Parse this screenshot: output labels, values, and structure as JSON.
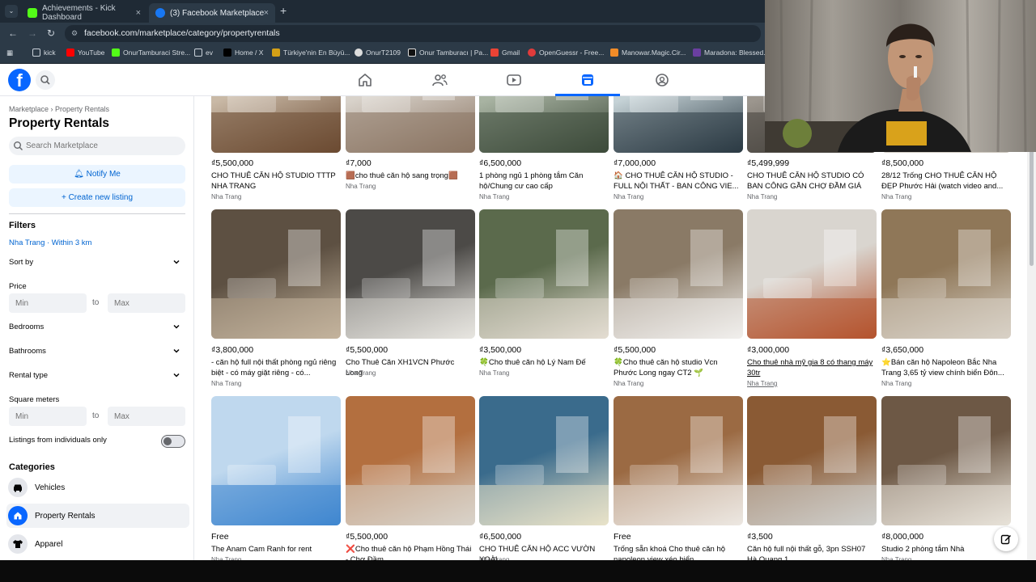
{
  "browser": {
    "tabs": [
      {
        "title": "Achievements - Kick Dashboard",
        "active": false,
        "favicon_color": "#53fc18"
      },
      {
        "title": "(3) Facebook Marketplace | Face",
        "active": true,
        "favicon_color": "#1877f2"
      }
    ],
    "url": "facebook.com/marketplace/category/propertyrentals",
    "bookmarks": [
      {
        "label": "kick",
        "icon": "folder-icon"
      },
      {
        "label": "YouTube",
        "icon": "youtube-icon"
      },
      {
        "label": "OnurTamburaci Stre...",
        "icon": "kick-icon"
      },
      {
        "label": "ev",
        "icon": "folder-icon"
      },
      {
        "label": "Home / X",
        "icon": "x-icon"
      },
      {
        "label": "Türkiye'nin En Büyü...",
        "icon": "bookmark-icon"
      },
      {
        "label": "OnurT2109",
        "icon": "bookmark-icon"
      },
      {
        "label": "Onur Tamburacı | Pa...",
        "icon": "bookmark-icon"
      },
      {
        "label": "Gmail",
        "icon": "gmail-icon"
      },
      {
        "label": "OpenGuessr - Free...",
        "icon": "bookmark-icon"
      },
      {
        "label": "Manowar.Magic.Cir...",
        "icon": "bookmark-icon"
      },
      {
        "label": "Maradona: Blessed...",
        "icon": "bookmark-icon"
      }
    ]
  },
  "sidebar": {
    "breadcrumb": "Marketplace › Property Rentals",
    "title": "Property Rentals",
    "search_placeholder": "Search Marketplace",
    "notify_label": "Notify Me",
    "create_label": "Create new listing",
    "filters_title": "Filters",
    "location_filter": "Nha Trang · Within 3 km",
    "sort_by": "Sort by",
    "price_label": "Price",
    "min_placeholder": "Min",
    "max_placeholder": "Max",
    "to_label": "to",
    "bedrooms": "Bedrooms",
    "bathrooms": "Bathrooms",
    "rental_type": "Rental type",
    "square_meters": "Square meters",
    "individuals_only": "Listings from individuals only",
    "categories_title": "Categories",
    "categories": [
      {
        "label": "Vehicles",
        "icon": "car-icon",
        "active": false
      },
      {
        "label": "Property Rentals",
        "icon": "house-icon",
        "active": true
      },
      {
        "label": "Apparel",
        "icon": "shirt-icon",
        "active": false
      }
    ]
  },
  "listings": [
    {
      "price": "₫5,500,000",
      "title": "CHO THUÊ CĂN HỘ STUDIO TTTP NHA TRANG",
      "location": "Nha Trang",
      "colors": [
        "#6b4a32",
        "#c9b9a6"
      ]
    },
    {
      "price": "₫7,000",
      "title": "🟫cho thuê căn hộ sang trọng🟫",
      "location": "Nha Trang",
      "colors": [
        "#8a7462",
        "#d8d2ca"
      ]
    },
    {
      "price": "₫6,500,000",
      "title": "1 phòng ngủ 1 phòng tắm Căn hộ/Chung cư cao cấp",
      "location": "Nha Trang",
      "colors": [
        "#3d4a3a",
        "#a8b3a2"
      ]
    },
    {
      "price": "₫7,000,000",
      "title": "🏠 CHO THUÊ CĂN HỘ STUDIO - FULL NỘI THẤT - BAN CÔNG VIE...",
      "location": "Nha Trang",
      "colors": [
        "#2b3a44",
        "#c5d2d6"
      ]
    },
    {
      "price": "₫5,499,999",
      "title": "CHO THUÊ CĂN HỘ STUDIO CÓ BAN CÔNG GẦN CHỢ ĐẦM GIÁ 5....",
      "location": "Nha Trang",
      "colors": [
        "#44403b",
        "#9c968e"
      ]
    },
    {
      "price": "₫8,500,000",
      "title": "28/12 Trống CHO THUÊ CĂN HỘ ĐẸP Phước Hải (watch video and...",
      "location": "Nha Trang",
      "colors": [
        "#ccc6bd",
        "#ebe7e1"
      ]
    },
    {
      "price": "₫3,800,000",
      "title": "- căn hộ full nội thất phòng ngủ riêng biệt - có máy giặt riêng - có...",
      "location": "Nha Trang",
      "colors": [
        "#c3b39c",
        "#5d5042"
      ]
    },
    {
      "price": "₫5,500,000",
      "title": "Cho Thuê Căn XH1VCN Phước Long",
      "location": "Nha Trang",
      "colors": [
        "#e7e5e0",
        "#4c4a47"
      ]
    },
    {
      "price": "₫3,500,000",
      "title": "🍀Cho thuê căn hộ Lý Nam Đế",
      "location": "Nha Trang",
      "colors": [
        "#e3ddd2",
        "#5b6a4c"
      ]
    },
    {
      "price": "₫5,500,000",
      "title": "🍀Cho thuê căn hộ studio Vcn Phước Long ngay CT2 🌱",
      "location": "Nha Trang",
      "colors": [
        "#f1efec",
        "#8a7a66"
      ]
    },
    {
      "price": "₫3,000,000",
      "title": "Cho thuê nhà mỹ gia 8 có thang máy 30tr",
      "location": "Nha Trang",
      "colors": [
        "#b5532e",
        "#d9d5cf"
      ]
    },
    {
      "price": "₫3,650,000",
      "title": "⭐Bán căn hộ Napoleon Bắc Nha Trang 3,65 tỷ view chính biển Đôn...",
      "location": "Nha Trang",
      "colors": [
        "#d8d1c6",
        "#8f7758"
      ]
    },
    {
      "price": "Free",
      "title": "The Anam Cam Ranh for rent",
      "location": "Nha Trang",
      "colors": [
        "#3f86cf",
        "#bfd8ee"
      ]
    },
    {
      "price": "₫5,500,000",
      "title": "❌Cho thuê căn hộ Phạm Hồng Thái - Chợ Đầm",
      "location": "Nha Trang",
      "colors": [
        "#d9d3ca",
        "#b36f3f"
      ]
    },
    {
      "price": "₫6,500,000",
      "title": "CHO THUÊ CĂN HỘ ACC VƯỜN XOÀI",
      "location": "Nha Trang",
      "colors": [
        "#e8e2c9",
        "#3a6b8c"
      ]
    },
    {
      "price": "Free",
      "title": "Trống sẵn khoá Cho thuê căn hộ napoleon view xéo biển",
      "location": "Nha Trang",
      "colors": [
        "#ece8e2",
        "#9b6a43"
      ]
    },
    {
      "price": "₫3,500",
      "title": "Căn hộ full nội thất gỗ, 3pn SSH07 Hà Quang 1",
      "location": "Nha Trang",
      "colors": [
        "#cfcfcc",
        "#8a5a34"
      ]
    },
    {
      "price": "₫8,000,000",
      "title": "Studio 2 phòng tắm Nhà",
      "location": "Nha Trang",
      "colors": [
        "#e7e2d8",
        "#6d5845"
      ]
    }
  ]
}
